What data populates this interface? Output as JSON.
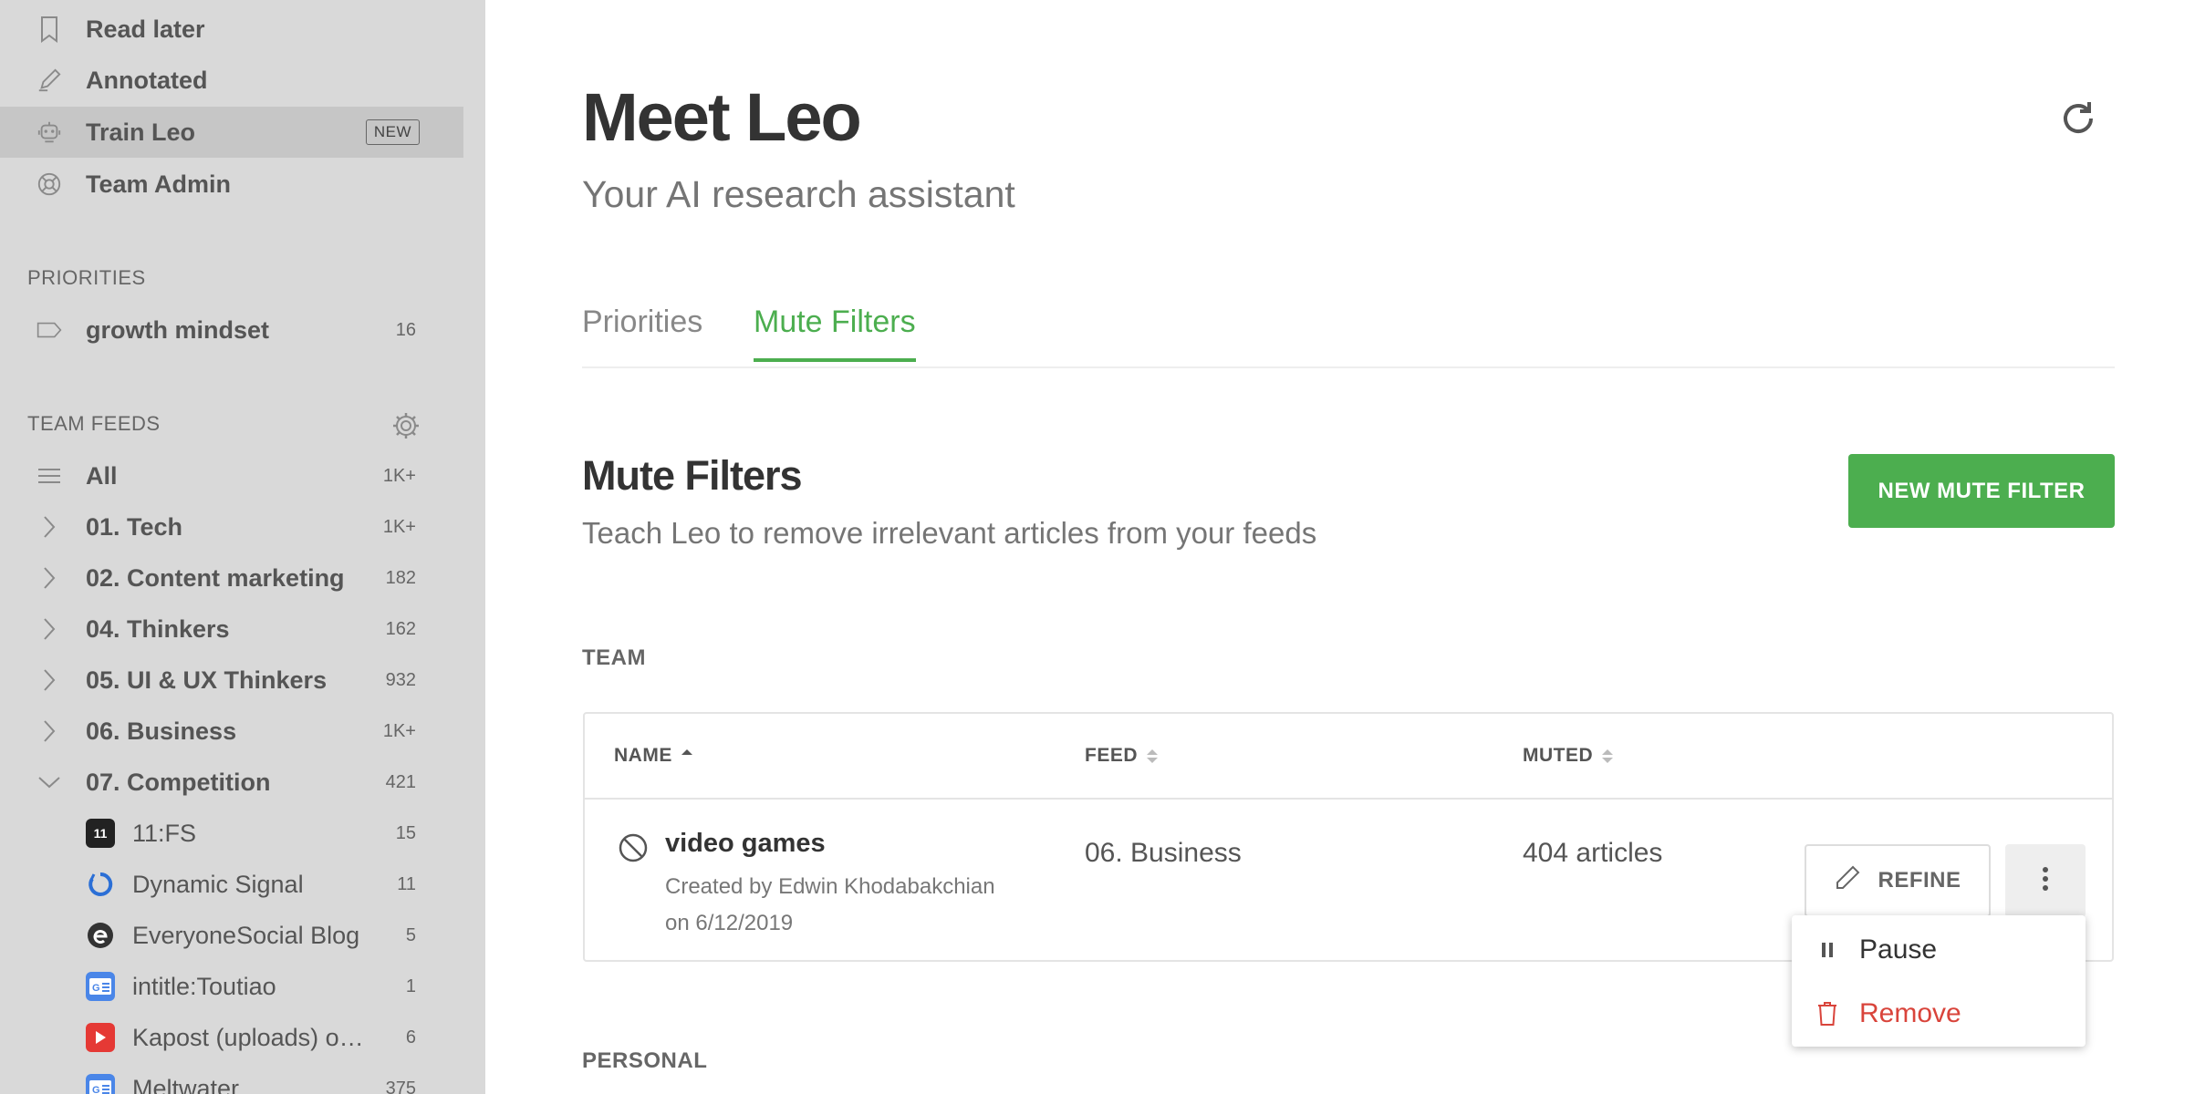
{
  "sidebar": {
    "nav": [
      {
        "label": "Read later",
        "icon": "bookmark-icon"
      },
      {
        "label": "Annotated",
        "icon": "pen-icon"
      },
      {
        "label": "Train Leo",
        "icon": "leo-robot-icon",
        "badge": "NEW",
        "active": true
      },
      {
        "label": "Team Admin",
        "icon": "lifebuoy-icon"
      }
    ],
    "priorities_heading": "PRIORITIES",
    "priorities": [
      {
        "label": "growth mindset",
        "count": "16",
        "icon": "tag-icon"
      }
    ],
    "team_feeds_heading": "TEAM FEEDS",
    "feeds": [
      {
        "label": "All",
        "count": "1K+",
        "icon": "list-icon"
      },
      {
        "label": "01. Tech",
        "count": "1K+",
        "icon": "chevron-right-icon"
      },
      {
        "label": "02. Content marketing",
        "count": "182",
        "icon": "chevron-right-icon"
      },
      {
        "label": "04. Thinkers",
        "count": "162",
        "icon": "chevron-right-icon"
      },
      {
        "label": "05. UI & UX Thinkers",
        "count": "932",
        "icon": "chevron-right-icon"
      },
      {
        "label": "06. Business",
        "count": "1K+",
        "icon": "chevron-right-icon"
      },
      {
        "label": "07. Competition",
        "count": "421",
        "icon": "chevron-down-icon"
      }
    ],
    "sub_feeds": [
      {
        "label": "11:FS",
        "count": "15",
        "icon": "11fs-logo-icon",
        "color": "#222222"
      },
      {
        "label": "Dynamic Signal",
        "count": "11",
        "icon": "dynamic-signal-logo-icon",
        "color": "#2b6fd6"
      },
      {
        "label": "EveryoneSocial Blog",
        "count": "5",
        "icon": "everyonesocial-logo-icon",
        "color": "#333333"
      },
      {
        "label": "intitle:Toutiao",
        "count": "1",
        "icon": "google-news-icon",
        "color": "#4a86e8"
      },
      {
        "label": "Kapost (uploads) on…",
        "count": "6",
        "icon": "youtube-icon",
        "color": "#e53935"
      },
      {
        "label": "Meltwater",
        "count": "375",
        "icon": "google-news-icon",
        "color": "#4a86e8"
      }
    ]
  },
  "main": {
    "title": "Meet Leo",
    "subtitle": "Your AI research assistant",
    "tabs": [
      {
        "label": "Priorities",
        "active": false
      },
      {
        "label": "Mute Filters",
        "active": true
      }
    ],
    "section_title": "Mute Filters",
    "section_subtitle": "Teach Leo to remove irrelevant articles from your feeds",
    "new_button": "NEW MUTE FILTER",
    "team_label": "TEAM",
    "personal_label": "PERSONAL",
    "table": {
      "columns": [
        "NAME",
        "FEED",
        "MUTED"
      ],
      "rows": [
        {
          "name": "video games",
          "created": "Created by Edwin Khodabakchian",
          "date": "on 6/12/2019",
          "feed": "06. Business",
          "muted": "404 articles",
          "refine": "REFINE"
        }
      ]
    },
    "menu": {
      "pause": "Pause",
      "remove": "Remove"
    }
  },
  "colors": {
    "accent": "#4cae4f",
    "danger": "#d9443b",
    "sidebar_bg": "#d9d9d9"
  }
}
